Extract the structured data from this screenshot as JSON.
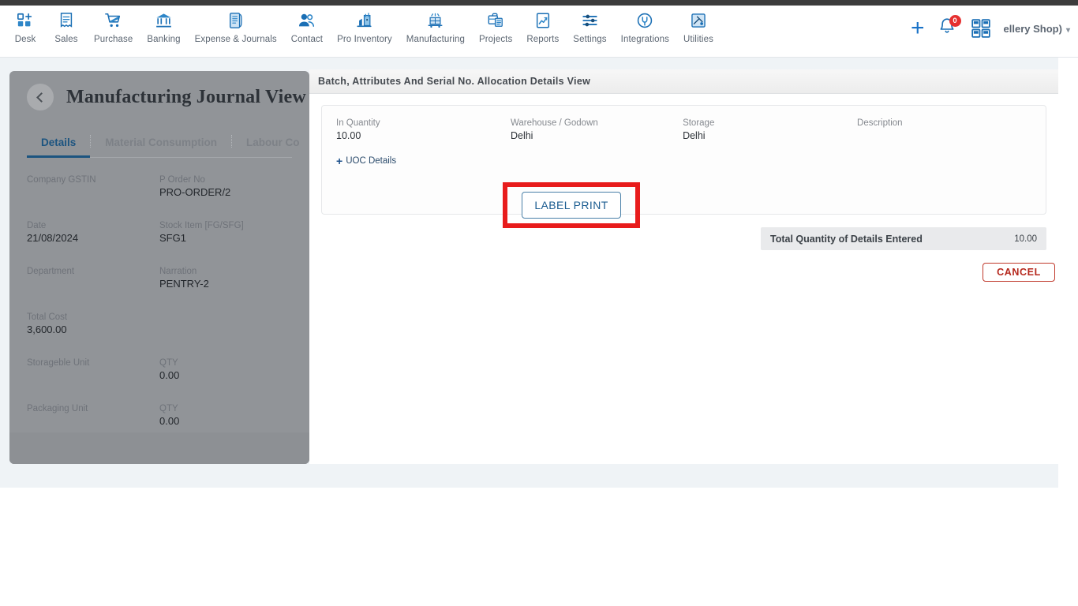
{
  "navbar": {
    "items": [
      {
        "label": "Desk",
        "icon": "desk-grid-plus-icon"
      },
      {
        "label": "Sales",
        "icon": "sales-receipt-icon"
      },
      {
        "label": "Purchase",
        "icon": "purchase-cart-icon"
      },
      {
        "label": "Banking",
        "icon": "banking-bank-icon"
      },
      {
        "label": "Expense & Journals",
        "icon": "expense-journal-icon"
      },
      {
        "label": "Contact",
        "icon": "contact-people-icon"
      },
      {
        "label": "Pro Inventory",
        "icon": "pro-inventory-icon"
      },
      {
        "label": "Manufacturing",
        "icon": "manufacturing-icon"
      },
      {
        "label": "Projects",
        "icon": "projects-briefcase-icon"
      },
      {
        "label": "Reports",
        "icon": "reports-chart-icon"
      },
      {
        "label": "Settings",
        "icon": "settings-sliders-icon"
      },
      {
        "label": "Integrations",
        "icon": "integrations-plug-icon"
      },
      {
        "label": "Utilities",
        "icon": "utilities-tools-icon"
      }
    ],
    "add_label": "+",
    "notification_count": "0",
    "company": "ellery Shop)",
    "caret": "▾",
    "accent_color": "#1a73c8"
  },
  "left_panel": {
    "title": "Manufacturing Journal View",
    "back_label": "Back",
    "tabs": [
      {
        "label": "Details",
        "active": true
      },
      {
        "label": "Material Consumption",
        "active": false
      },
      {
        "label": "Labour Co",
        "active": false
      }
    ],
    "fields": [
      {
        "label": "Company GSTIN",
        "value": ""
      },
      {
        "label": "P Order No",
        "value": "PRO-ORDER/2"
      },
      {
        "label": "Date",
        "value": "21/08/2024"
      },
      {
        "label": "Stock Item [FG/SFG]",
        "value": "SFG1"
      },
      {
        "label": "Department",
        "value": ""
      },
      {
        "label": "Narration",
        "value": "PENTRY-2"
      },
      {
        "label": "Total Cost",
        "value": "3,600.00"
      },
      {
        "label": "",
        "value": ""
      },
      {
        "label": "Storageble Unit",
        "value": ""
      },
      {
        "label": "QTY",
        "value": "0.00"
      },
      {
        "label": "Packaging Unit",
        "value": ""
      },
      {
        "label": "QTY",
        "value": "0.00"
      }
    ]
  },
  "modal": {
    "header_title": "Batch, Attributes And Serial No. Allocation Details View",
    "allocation": {
      "in_quantity_label": "In Quantity",
      "in_quantity_value": "10.00",
      "warehouse_label": "Warehouse / Godown",
      "warehouse_value": "Delhi",
      "storage_label": "Storage",
      "storage_value": "Delhi",
      "description_label": "Description",
      "description_value": "",
      "uoc_details_label": "UOC Details",
      "uoc_plus": "+",
      "label_print_button": "LABEL PRINT"
    },
    "total_label": "Total Quantity of Details Entered",
    "total_value": "10.00",
    "cancel_label": "CANCEL",
    "highlight_color": "#e81c1c"
  }
}
